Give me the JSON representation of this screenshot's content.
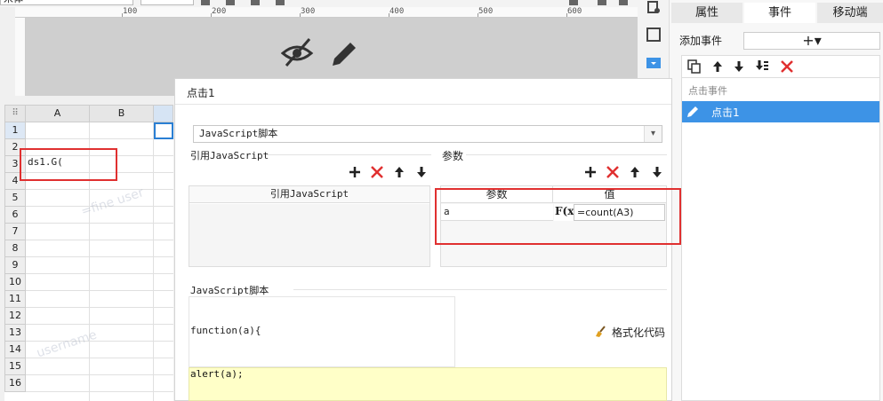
{
  "toolbar": {
    "font_name": "宋体"
  },
  "ruler": {
    "marks": [
      "100",
      "200",
      "300",
      "400",
      "500",
      "600"
    ]
  },
  "sheet": {
    "columns": [
      "A",
      "B"
    ],
    "rows": [
      "1",
      "2",
      "3",
      "4",
      "5",
      "6",
      "7",
      "8",
      "9",
      "10",
      "11",
      "12",
      "13",
      "14",
      "15",
      "16"
    ],
    "corner": "⠿",
    "cell_a3": "ds1.G("
  },
  "watermark": {
    "line1": "=fine user",
    "line2": "username"
  },
  "right_panel": {
    "tabs": [
      "属性",
      "事件",
      "移动端"
    ],
    "add_event_label": "添加事件",
    "add_event_symbol": "+▾",
    "event_group": "点击事件",
    "event_item": "点击1"
  },
  "dialog": {
    "title": "点击1",
    "type_value": "JavaScript脚本",
    "ref_section": "引用JavaScript",
    "param_section": "参数",
    "ref_column": "引用JavaScript",
    "param_columns": [
      "参数",
      "值"
    ],
    "param_rows": [
      {
        "name": "a",
        "fx": "F(x)",
        "value": "=count(A3)"
      }
    ],
    "script_section": "JavaScript脚本",
    "code_line1": "function(a){",
    "code_line2": "alert(a);",
    "format_button": "格式化代码"
  },
  "colors": {
    "accent": "#3d93e6",
    "highlight_box": "#e03030",
    "delete_icon": "#e03030",
    "code_highlight": "#ffffc8"
  }
}
